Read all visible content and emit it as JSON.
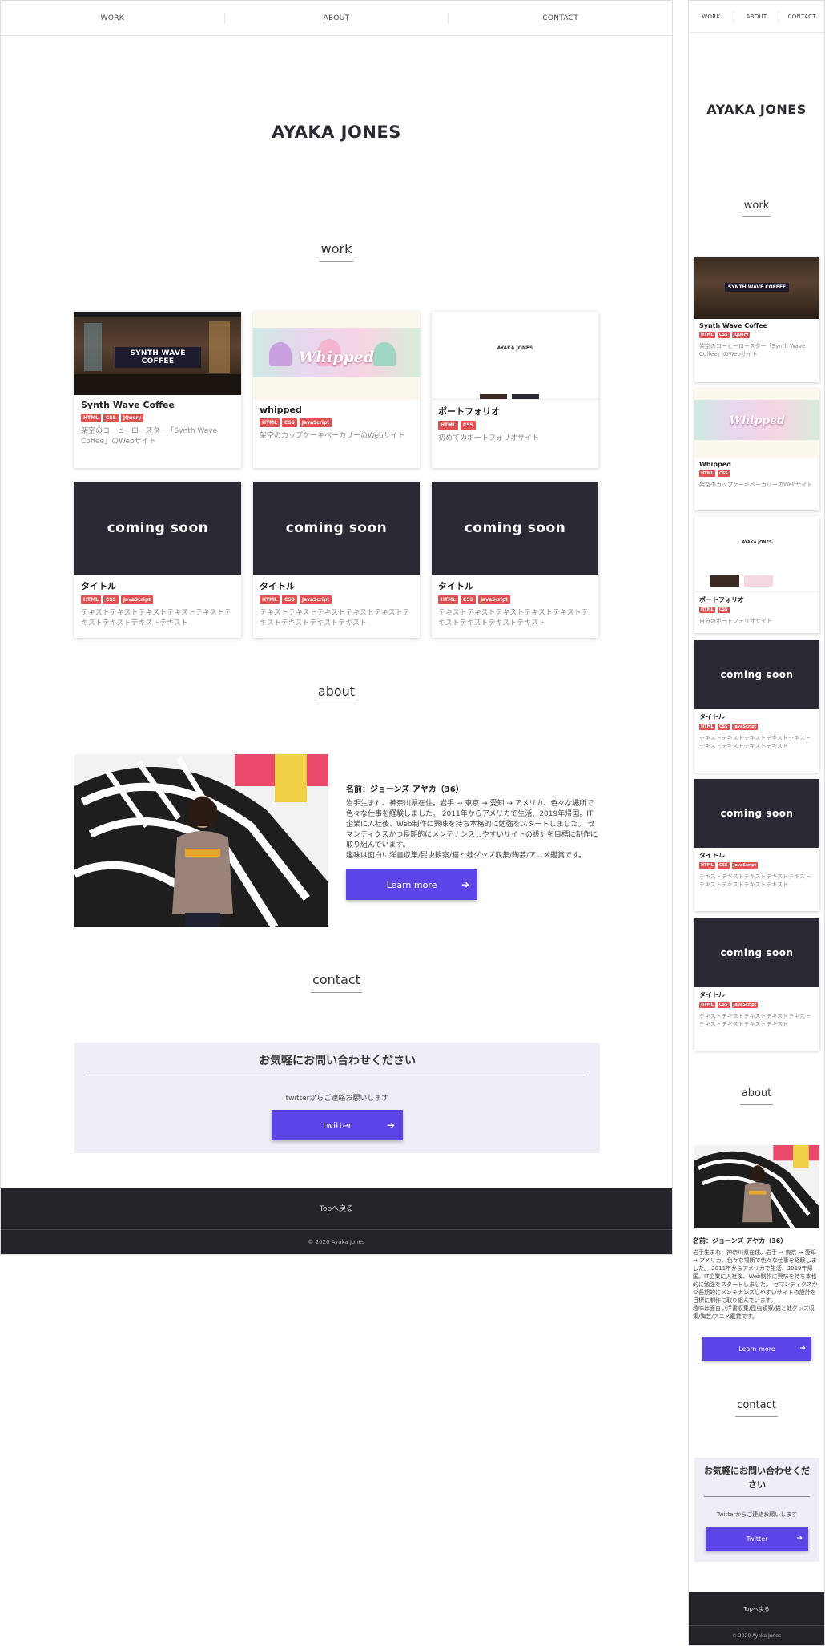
{
  "nav": {
    "work": "WORK",
    "about": "ABOUT",
    "contact": "CONTACT"
  },
  "hero_name": "AYAKA JONES",
  "sections": {
    "work": "work",
    "about": "about",
    "contact": "contact"
  },
  "works": [
    {
      "title": "Synth Wave Coffee",
      "tags": [
        "HTML",
        "CSS",
        "JQuery"
      ],
      "desc": "架空のコーヒーロースター「Synth Wave Coffee」のWebサイト",
      "thumb": "SYNTH WAVE COFFEE"
    },
    {
      "title": "whipped",
      "tags": [
        "HTML",
        "CSS",
        "JavaScript"
      ],
      "desc": "架空のカップケーキベーカリーのWebサイト",
      "thumb": "Whipped"
    },
    {
      "title": "ポートフォリオ",
      "tags": [
        "HTML",
        "CSS"
      ],
      "desc": "初めてのポートフォリオサイト",
      "thumb": "AYAKA JONES"
    },
    {
      "title": "タイトル",
      "tags": [
        "HTML",
        "CSS",
        "JavaScript"
      ],
      "desc": "テキストテキストテキストテキストテキストテキストテキストテキストテキスト",
      "thumb": "coming soon"
    },
    {
      "title": "タイトル",
      "tags": [
        "HTML",
        "CSS",
        "JavaScript"
      ],
      "desc": "テキストテキストテキストテキストテキストテキストテキストテキストテキスト",
      "thumb": "coming soon"
    },
    {
      "title": "タイトル",
      "tags": [
        "HTML",
        "CSS",
        "JavaScript"
      ],
      "desc": "テキストテキストテキストテキストテキストテキストテキストテキストテキスト",
      "thumb": "coming soon"
    }
  ],
  "mobile_works": [
    {
      "title": "Synth Wave Coffee",
      "tags": [
        "HTML",
        "CSS",
        "JQuery"
      ],
      "desc": "架空のコーヒーロースター「Synth Wave Coffee」のWebサイト"
    },
    {
      "title": "Whipped",
      "tags": [
        "HTML",
        "CSS"
      ],
      "desc": "架空のカップケーキベーカリーのWebサイト"
    },
    {
      "title": "ポートフォリオ",
      "tags": [
        "HTML",
        "CSS"
      ],
      "desc": "自分のポートフォリオサイト"
    },
    {
      "title": "タイトル",
      "tags": [
        "HTML",
        "CSS",
        "JavaScript"
      ],
      "desc": "テキストテキストテキストテキストテキストテキストテキストテキストテキスト"
    },
    {
      "title": "タイトル",
      "tags": [
        "HTML",
        "CSS",
        "JavaScript"
      ],
      "desc": "テキストテキストテキストテキストテキストテキストテキストテキストテキスト"
    },
    {
      "title": "タイトル",
      "tags": [
        "HTML",
        "CSS",
        "JavaScript"
      ],
      "desc": "テキストテキストテキストテキストテキストテキストテキストテキストテキスト"
    }
  ],
  "about": {
    "name": "名前：ジョーンズ アヤカ（36）",
    "bio": "岩手生まれ、神奈川県在住。岩手 → 東京 → 愛知 → アメリカ、色々な場所で色々な仕事を経験しました。 2011年からアメリカで生活、2019年帰国。IT企業に入社後、Web制作に興味を持ち本格的に勉強をスタートしました。 セマンティクスかつ長期的にメンテナンスしやすいサイトの設計を目標に制作に取り組んでいます。",
    "hobby": "趣味は面白い洋書収集/昆虫観察/猫と蛙グッズ収集/陶芸/アニメ鑑賞です。",
    "button": "Learn more"
  },
  "contact": {
    "heading": "お気軽にお問い合わせください",
    "text": "twitterからご連絡お願いします",
    "button": "twitter",
    "button_mobile": "Twitter",
    "text_mobile": "Twitterからご連絡お願いします"
  },
  "footer": {
    "top": "Topへ戻る",
    "copyright": "© 2020 Ayaka Jones"
  },
  "colors": {
    "accent": "#5b45e6",
    "tag": "#e05252",
    "dark": "#23232a",
    "contact_bg": "#eeeff6"
  }
}
